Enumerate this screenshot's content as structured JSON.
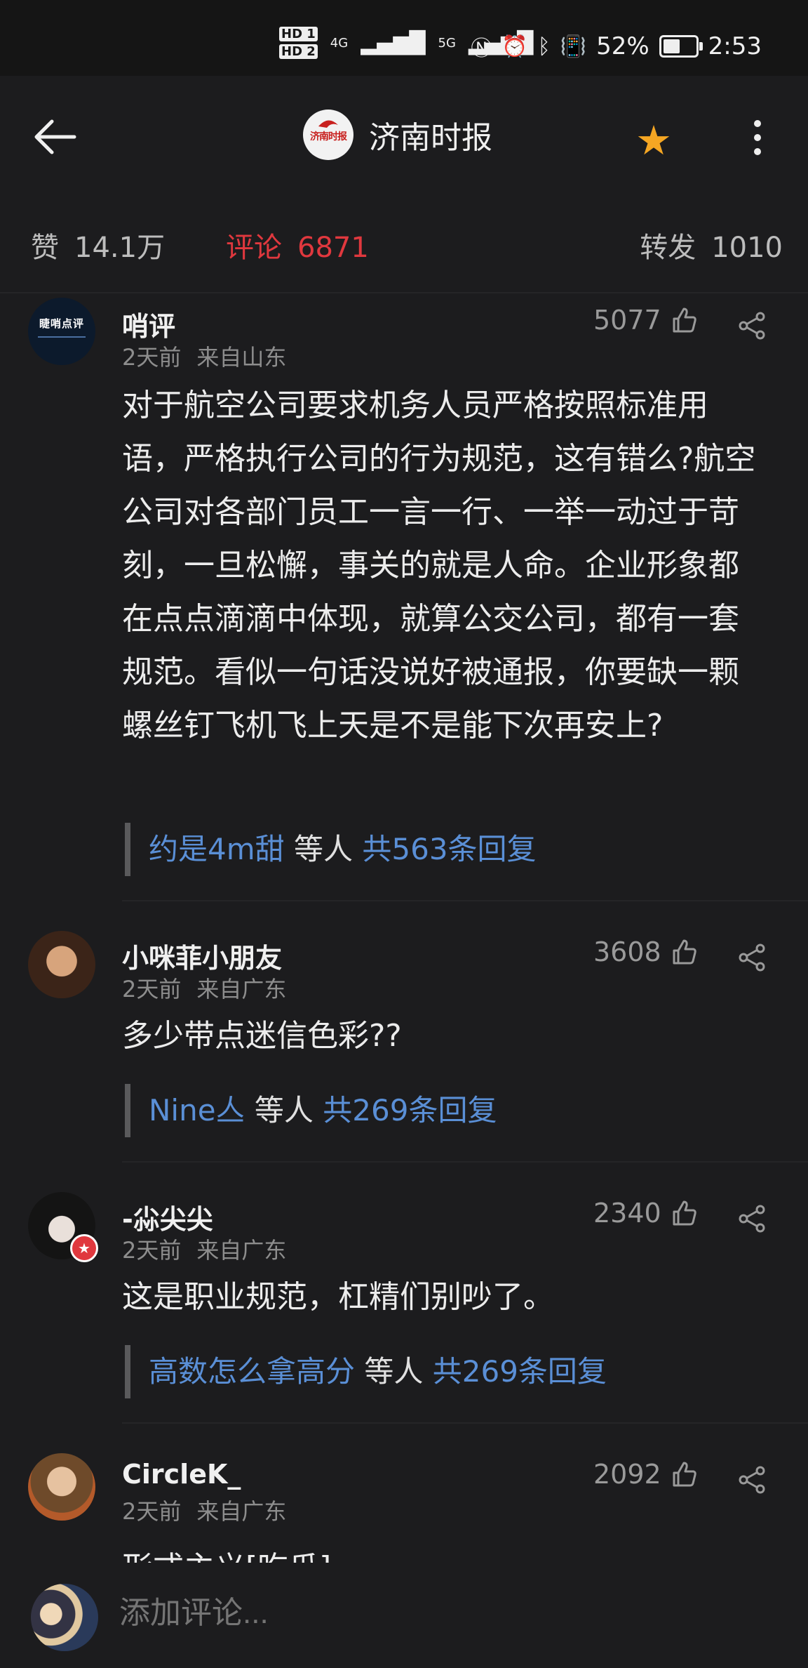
{
  "status_bar": {
    "sim1": "HD 1",
    "sim2": "HD 2",
    "net1": "4G",
    "net2": "5G",
    "battery": "52%",
    "battery_level": 0.52,
    "time": "2:53"
  },
  "header": {
    "channel_name": "济南时报",
    "logo_text": "济南时报"
  },
  "stats": {
    "likes_label": "赞",
    "likes_value": "14.1万",
    "comments_label": "评论",
    "comments_value": "6871",
    "reposts_label": "转发",
    "reposts_value": "1010"
  },
  "comments": [
    {
      "user": "哨评",
      "time": "2天前",
      "location": "来自山东",
      "likes": "5077",
      "text": "对于航空公司要求机务人员严格按照标准用语，严格执行公司的行为规范，这有错么?航空公司对各部门员工一言一行、一举一动过于苛刻，一旦松懈，事关的就是人命。企业形象都在点点滴滴中体现，就算公交公司，都有一套规范。看似一句话没说好被通报，你要缺一颗螺丝钉飞机飞上天是不是能下次再安上?",
      "reply_user": "约是4m甜",
      "reply_mid": "等人",
      "reply_count": "共563条回复",
      "avatar_text": "睫哨点评"
    },
    {
      "user": "小咪菲小朋友",
      "time": "2天前",
      "location": "来自广东",
      "likes": "3608",
      "text": "多少带点迷信色彩??",
      "reply_user": "Nine亼",
      "reply_mid": "等人",
      "reply_count": "共269条回复"
    },
    {
      "user": "-尛尖尖",
      "time": "2天前",
      "location": "来自广东",
      "likes": "2340",
      "text": "这是职业规范，杠精们别吵了。",
      "reply_user": "高数怎么拿高分",
      "reply_mid": "等人",
      "reply_count": "共269条回复"
    },
    {
      "user": "CircleK_",
      "time": "2天前",
      "location": "来自广东",
      "likes": "2092",
      "text": "形式主义[吃瓜]"
    }
  ],
  "bottom": {
    "placeholder": "添加评论..."
  },
  "colors": {
    "accent_red": "#e0383e",
    "link_blue": "#5a8fd6",
    "star": "#f5a623",
    "background": "#1c1c1e"
  }
}
